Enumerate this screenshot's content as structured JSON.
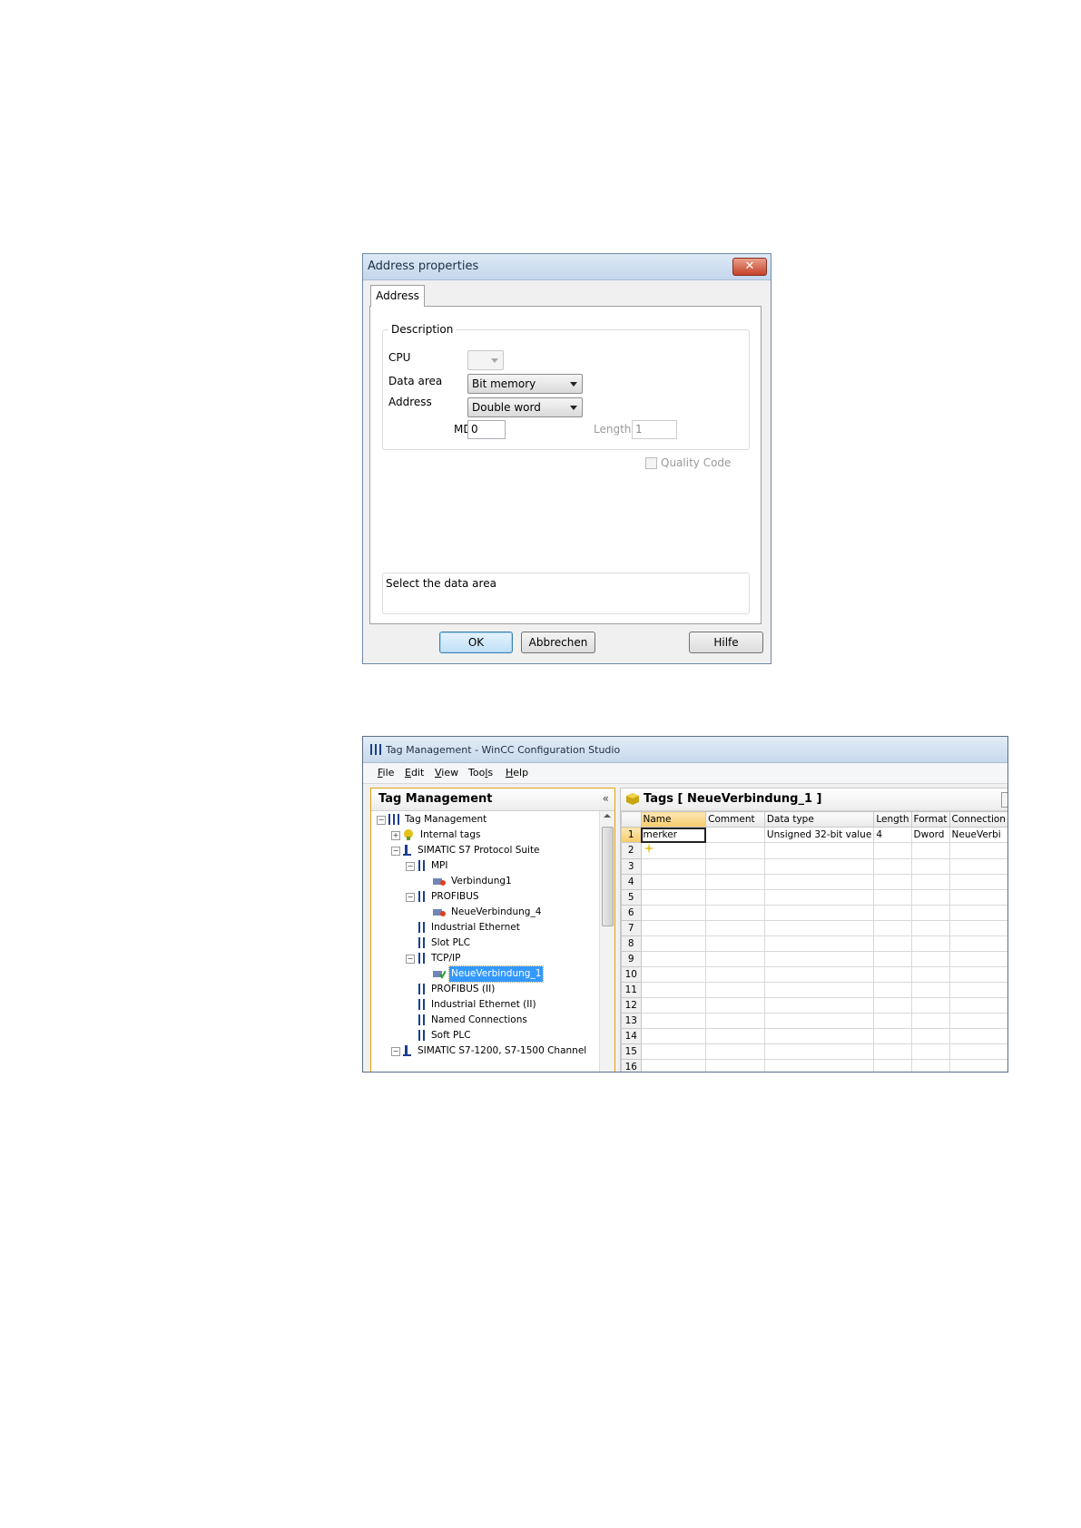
{
  "dialog": {
    "title": "Address properties",
    "close_glyph": "✕",
    "tab_label": "Address",
    "group_label": "Description",
    "cpu_label": "CPU",
    "data_area_label": "Data area",
    "data_area_value": "Bit memory",
    "address_label": "Address",
    "address_value": "Double word",
    "md_label": "MD",
    "md_value": "0",
    "length_label": "Length",
    "length_value": "1",
    "quality_code_label": "Quality Code",
    "hint_text": "Select the data area",
    "ok_label": "OK",
    "cancel_label": "Abbrechen",
    "help_label": "Hilfe"
  },
  "window": {
    "title": "Tag Management - WinCC Configuration Studio",
    "menu": [
      {
        "accel": "F",
        "rest": "ile"
      },
      {
        "accel": "E",
        "rest": "dit"
      },
      {
        "accel": "V",
        "rest": "iew"
      },
      {
        "accel": "",
        "rest": "Too",
        "accel2": "l",
        "rest2": "s"
      },
      {
        "accel": "H",
        "rest": "elp"
      }
    ],
    "nav_title": "Tag Management",
    "nav_collapse": "«",
    "tree": [
      {
        "label": "Tag Management"
      },
      {
        "label": "Internal tags"
      },
      {
        "label": "SIMATIC S7 Protocol Suite"
      },
      {
        "label": "MPI"
      },
      {
        "label": "Verbindung1"
      },
      {
        "label": "PROFIBUS"
      },
      {
        "label": "NeueVerbindung_4"
      },
      {
        "label": "Industrial Ethernet"
      },
      {
        "label": "Slot PLC"
      },
      {
        "label": "TCP/IP"
      },
      {
        "label": "NeueVerbindung_1"
      },
      {
        "label": "PROFIBUS (II)"
      },
      {
        "label": "Industrial Ethernet (II)"
      },
      {
        "label": "Named Connections"
      },
      {
        "label": "Soft PLC"
      },
      {
        "label": "SIMATIC S7-1200, S7-1500 Channel"
      }
    ],
    "tags_title": "Tags [ NeueVerbindung_1 ]",
    "columns": [
      "Name",
      "Comment",
      "Data type",
      "Length",
      "Format",
      "Connection"
    ],
    "rows": [
      {
        "n": "1",
        "name": "merker",
        "comment": "",
        "datatype": "Unsigned 32-bit value",
        "length": "4",
        "format": "Dword",
        "connection": "NeueVerbi"
      },
      {
        "n": "2"
      },
      {
        "n": "3"
      },
      {
        "n": "4"
      },
      {
        "n": "5"
      },
      {
        "n": "6"
      },
      {
        "n": "7"
      },
      {
        "n": "8"
      },
      {
        "n": "9"
      },
      {
        "n": "10"
      },
      {
        "n": "11"
      },
      {
        "n": "12"
      },
      {
        "n": "13"
      },
      {
        "n": "14"
      },
      {
        "n": "15"
      },
      {
        "n": "16"
      }
    ],
    "colors": {
      "accent_border": "#e0a010",
      "selection": "#3399ff"
    }
  }
}
